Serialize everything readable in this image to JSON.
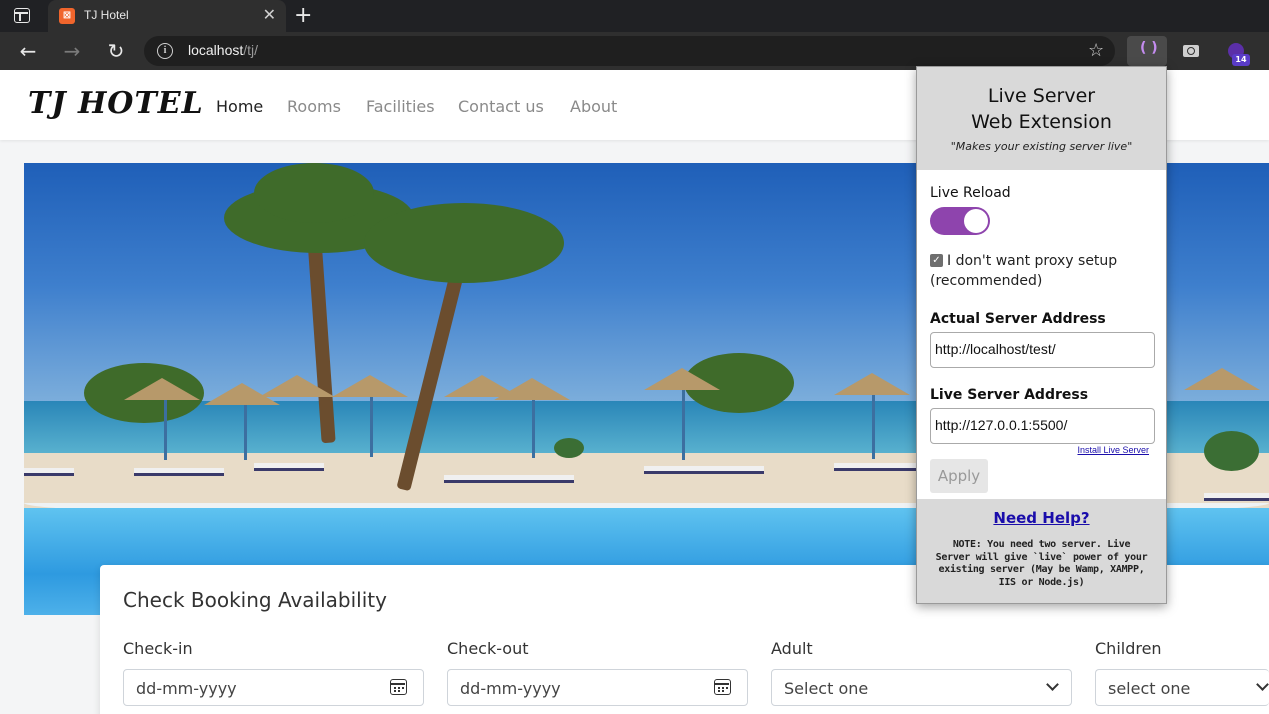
{
  "browser": {
    "tab_title": "TJ Hotel",
    "tab_favicon": "xampp-icon",
    "url_host": "localhost",
    "url_path": "/tj/",
    "profile_badge": "14"
  },
  "site": {
    "brand": "TJ HOTEL",
    "nav": [
      {
        "label": "Home",
        "active": true
      },
      {
        "label": "Rooms"
      },
      {
        "label": "Facilities"
      },
      {
        "label": "Contact us"
      },
      {
        "label": "About"
      }
    ]
  },
  "booking": {
    "title": "Check Booking Availability",
    "fields": [
      {
        "label": "Check-in",
        "value": "dd-mm-yyyy"
      },
      {
        "label": "Check-out",
        "value": "dd-mm-yyyy"
      },
      {
        "label": "Adult",
        "value": "Select one"
      },
      {
        "label": "Children",
        "value": "select one"
      }
    ]
  },
  "popup": {
    "title_line1": "Live Server",
    "title_line2": "Web Extension",
    "tagline": "\"Makes your existing server live\"",
    "live_reload_label": "Live Reload",
    "live_reload_on": true,
    "checkbox_label": "I don't want proxy setup (recommended)",
    "checkbox_checked": true,
    "actual_address_label": "Actual Server Address",
    "actual_address_value": "http://localhost/test/",
    "live_address_label": "Live Server Address",
    "live_address_value": "http://127.0.0.1:5500/",
    "install_link": "Install Live Server",
    "apply_label": "Apply",
    "help_label": "Need Help?",
    "note": "NOTE: You need two server. Live Server will give `live` power of your existing server (May be Wamp, XAMPP, IIS or Node.js)"
  },
  "colors": {
    "toggle_on": "#8e44ad",
    "browser_bg": "#2f2f2f",
    "popup_header": "#d9d9d9"
  }
}
